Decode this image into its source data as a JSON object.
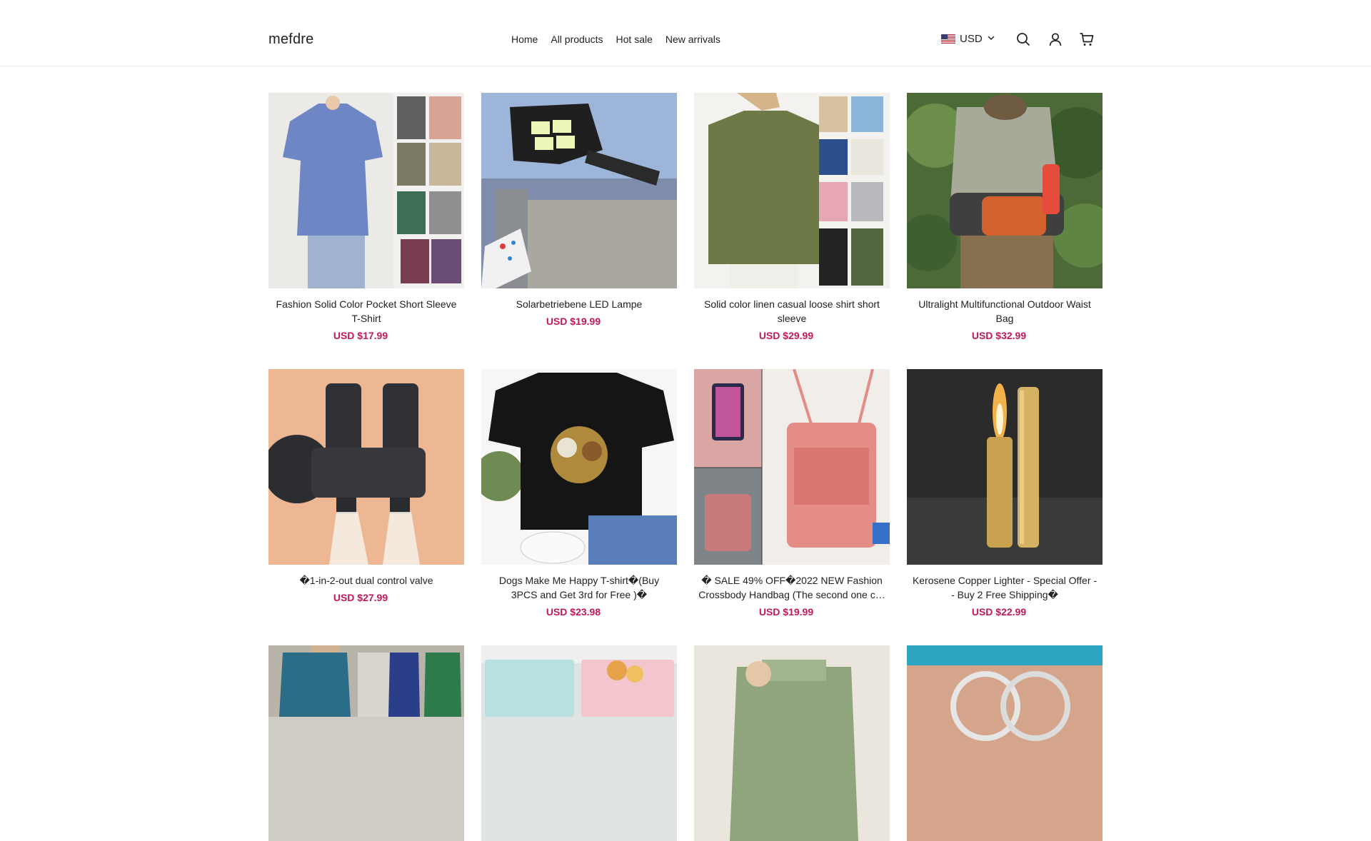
{
  "store": {
    "logo": "mefdre"
  },
  "nav": {
    "items": [
      "Home",
      "All products",
      "Hot sale",
      "New arrivals"
    ]
  },
  "currency": {
    "label": "USD"
  },
  "icons": {
    "search": "search-icon",
    "account": "user-icon",
    "cart": "cart-icon",
    "chevron": "chevron-down-icon",
    "flag": "us-flag-icon"
  },
  "colors": {
    "price": "#c2185b",
    "divider": "#ececec"
  },
  "products": [
    {
      "title": "Fashion Solid Color Pocket Short Sleeve T-Shirt",
      "price": "USD $17.99"
    },
    {
      "title": "Solarbetriebene LED Lampe",
      "price": "USD $19.99"
    },
    {
      "title": "Solid color linen casual loose shirt short sleeve",
      "price": "USD $29.99"
    },
    {
      "title": "Ultralight Multifunctional Outdoor Waist Bag",
      "price": "USD $32.99"
    },
    {
      "title": "�1-in-2-out dual control valve",
      "price": "USD $27.99"
    },
    {
      "title": "Dogs Make Me Happy T-shirt�(Buy 3PCS and Get 3rd for Free )�",
      "price": "USD $23.98"
    },
    {
      "title": "� SALE 49% OFF�2022 NEW Fashion Crossbody Handbag (The second one c…",
      "price": "USD $19.99"
    },
    {
      "title": "Kerosene Copper Lighter - Special Offer -- Buy 2 Free Shipping�",
      "price": "USD $22.99"
    }
  ]
}
